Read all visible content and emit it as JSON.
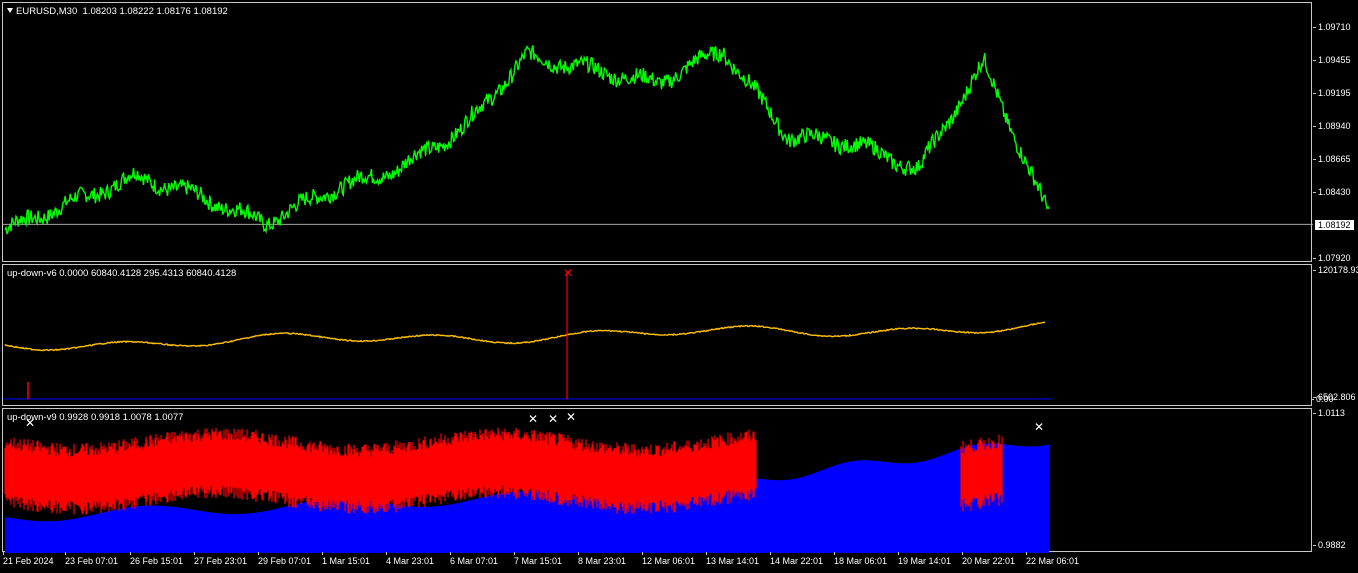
{
  "main": {
    "symbol_label": "EURUSD,M30",
    "ohlc": "1.08203 1.08222 1.08176 1.08192",
    "current_price": "1.08192",
    "price_ticks": [
      "1.09710",
      "1.09455",
      "1.09195",
      "1.08940",
      "1.08665",
      "1.08430",
      "1.07920"
    ],
    "line_color": "#00ff00"
  },
  "indicator_v6": {
    "label": "up-down-v6 0.0000 60840.4128 295.4313 60840.4128",
    "ticks": [
      "120178.93",
      "6502.806",
      "0.00"
    ],
    "line_color": "#ffc000",
    "spike_color": "#ff0000",
    "zero_line_color": "#0000ff"
  },
  "indicator_v9": {
    "label": "up-down-v9 0.9928 0.9918 1.0078 1.0077",
    "ticks": [
      "1.0113",
      "0.9882"
    ],
    "bear_color": "#ff0000",
    "bull_color": "#0000ff"
  },
  "time_axis": [
    "21 Feb 2024",
    "23 Feb 07:01",
    "26 Feb 15:01",
    "27 Feb 23:01",
    "29 Feb 07:01",
    "1 Mar 15:01",
    "4 Mar 23:01",
    "6 Mar 07:01",
    "7 Mar 15:01",
    "8 Mar 23:01",
    "12 Mar 06:01",
    "13 Mar 14:01",
    "14 Mar 22:01",
    "18 Mar 06:01",
    "19 Mar 14:01",
    "20 Mar 22:01",
    "22 Mar 06:01"
  ],
  "chart_data": {
    "type": "line",
    "title": "EURUSD,M30",
    "x": [
      "21 Feb 2024",
      "23 Feb 07:01",
      "26 Feb 15:01",
      "27 Feb 23:01",
      "29 Feb 07:01",
      "1 Mar 15:01",
      "4 Mar 23:01",
      "6 Mar 07:01",
      "7 Mar 15:01",
      "8 Mar 23:01",
      "12 Mar 06:01",
      "13 Mar 14:01",
      "14 Mar 22:01",
      "18 Mar 06:01",
      "19 Mar 14:01",
      "20 Mar 22:01",
      "22 Mar 06:01"
    ],
    "series": [
      {
        "name": "EURUSD",
        "values": [
          1.0815,
          1.0835,
          1.0855,
          1.084,
          1.082,
          1.0845,
          1.086,
          1.089,
          1.0945,
          1.0935,
          1.0925,
          1.095,
          1.0885,
          1.088,
          1.086,
          1.094,
          1.0825
        ]
      }
    ],
    "ylim": [
      1.079,
      1.0985
    ]
  }
}
